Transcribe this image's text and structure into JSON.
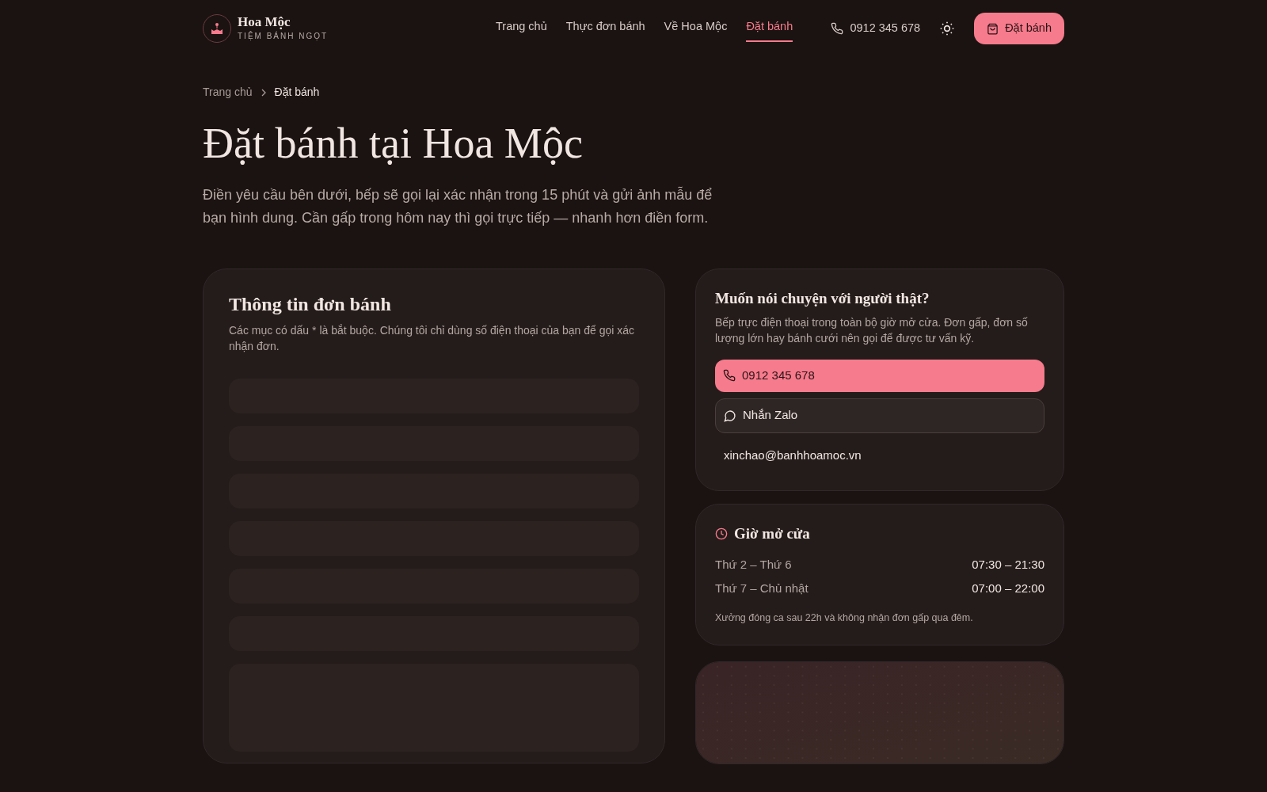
{
  "brand": {
    "name": "Hoa Mộc",
    "tagline": "TIỆM BÁNH NGỌT"
  },
  "nav": [
    {
      "label": "Trang chủ",
      "selected": false
    },
    {
      "label": "Thực đơn bánh",
      "selected": false
    },
    {
      "label": "Về Hoa Mộc",
      "selected": false
    },
    {
      "label": "Đặt bánh",
      "selected": true
    }
  ],
  "header_phone": "0912 345 678",
  "header_cta": "Đặt bánh",
  "breadcrumb": [
    {
      "label": "Trang chủ",
      "selected": false
    },
    {
      "label": "Đặt bánh",
      "selected": true
    }
  ],
  "page_title": "Đặt bánh tại Hoa Mộc",
  "intro": "Điền yêu cầu bên dưới, bếp sẽ gọi lại xác nhận trong 15 phút và gửi ảnh mẫu để bạn hình dung. Cần gấp trong hôm nay thì gọi trực tiếp — nhanh hơn điền form.",
  "form_card": {
    "title": "Thông tin đơn bánh",
    "note": "Các mục có dấu * là bắt buộc. Chúng tôi chỉ dùng số điện thoại của bạn để gọi xác nhận đơn.",
    "skeletons": [
      {
        "kind": "line"
      },
      {
        "kind": "line"
      },
      {
        "kind": "line"
      },
      {
        "kind": "line"
      },
      {
        "kind": "line"
      },
      {
        "kind": "line"
      },
      {
        "kind": "block"
      }
    ]
  },
  "contact_card": {
    "title": "Muốn nói chuyện với người thật?",
    "text": "Bếp trực điện thoại trong toàn bộ giờ mở cửa. Đơn gấp, đơn số lượng lớn hay bánh cưới nên gọi để được tư vấn kỹ.",
    "actions": [
      {
        "kind": "call",
        "label": "0912 345 678"
      },
      {
        "kind": "chat",
        "label": "Nhắn Zalo"
      },
      {
        "kind": "email",
        "label": "xinchao@banhhoamoc.vn"
      }
    ]
  },
  "hours_card": {
    "title": "Giờ mở cửa",
    "rows": [
      {
        "days": "Thứ 2 – Thứ 6",
        "time": "07:30 – 21:30"
      },
      {
        "days": "Thứ 7 – Chủ nhật",
        "time": "07:00 – 22:00"
      }
    ],
    "note": "Xưởng đóng ca sau 22h và không nhận đơn gấp qua đêm."
  }
}
